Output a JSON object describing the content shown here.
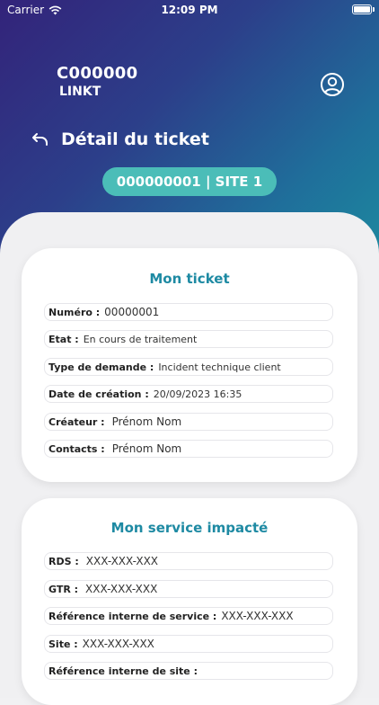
{
  "status_bar": {
    "carrier": "Carrier",
    "time": "12:09 PM"
  },
  "header": {
    "code": "C000000",
    "company": "LINKT",
    "title": "Détail du ticket"
  },
  "ticket_pill": "000000001 | SITE 1",
  "ticket_card": {
    "title": "Mon ticket",
    "rows": [
      {
        "label": "Numéro :",
        "value": "00000001"
      },
      {
        "label": "Etat :",
        "value": "En cours de traitement"
      },
      {
        "label": "Type de demande :",
        "value": "Incident technique client"
      },
      {
        "label": "Date de création :",
        "value": "20/09/2023 16:35"
      },
      {
        "label": "Créateur :",
        "value": "Prénom Nom"
      },
      {
        "label": "Contacts :",
        "value": "Prénom Nom"
      }
    ]
  },
  "service_card": {
    "title": "Mon service impacté",
    "rows": [
      {
        "label": "RDS :",
        "value": "XXX-XXX-XXX"
      },
      {
        "label": "GTR :",
        "value": "XXX-XXX-XXX"
      },
      {
        "label": "Référence interne de service :",
        "value": "XXX-XXX-XXX"
      },
      {
        "label": "Site :",
        "value": "XXX-XXX-XXX"
      },
      {
        "label": "Référence interne de site :",
        "value": ""
      }
    ]
  }
}
